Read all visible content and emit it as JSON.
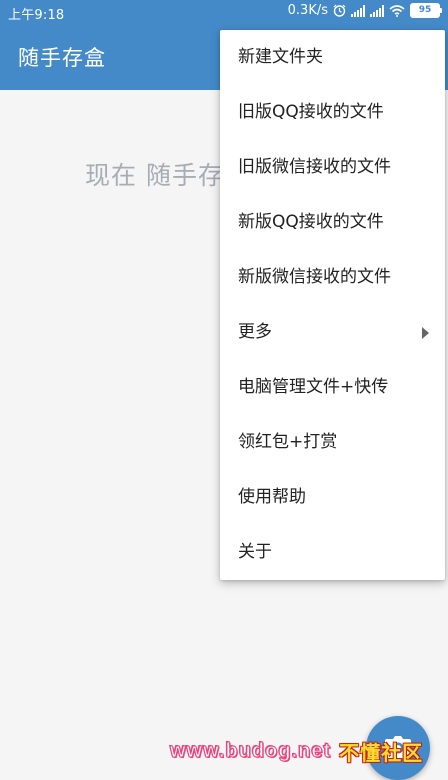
{
  "status_bar": {
    "time": "上午9:18",
    "network_speed": "0.3K/s",
    "battery": "95"
  },
  "app_bar": {
    "title": "随手存盒"
  },
  "main": {
    "empty_message": "现在 随手存盒 里是空的"
  },
  "menu": {
    "items": [
      {
        "label": "新建文件夹"
      },
      {
        "label": "旧版QQ接收的文件"
      },
      {
        "label": "旧版微信接收的文件"
      },
      {
        "label": "新版QQ接收的文件"
      },
      {
        "label": "新版微信接收的文件"
      },
      {
        "label": "更多",
        "has_submenu": true
      },
      {
        "label": "电脑管理文件+快传"
      },
      {
        "label": "领红包+打赏"
      },
      {
        "label": "使用帮助"
      },
      {
        "label": "关于"
      }
    ]
  },
  "watermark": {
    "url": "www.budog.net",
    "name": "不懂社区"
  },
  "colors": {
    "primary": "#448ac9",
    "empty_text": "#a7adb5",
    "menu_text": "#222222"
  },
  "icons": {
    "fab": "camera-icon",
    "status": [
      "alarm-icon",
      "signal-icon",
      "signal-icon",
      "wifi-icon",
      "battery-icon"
    ],
    "menu_more": "chevron-right-icon"
  }
}
